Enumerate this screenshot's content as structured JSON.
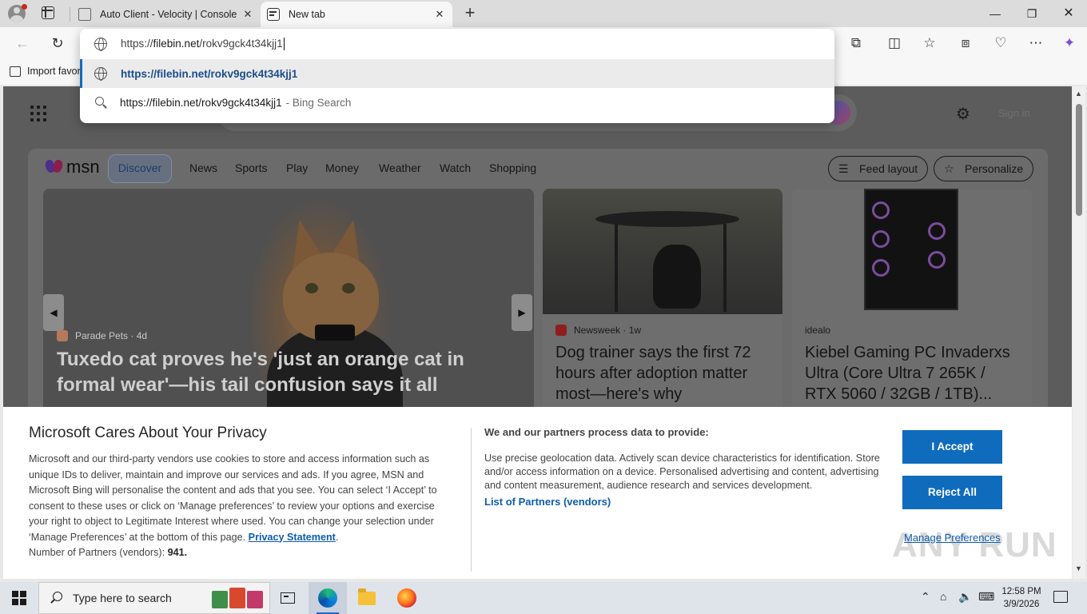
{
  "browser": {
    "tabs": [
      {
        "title": "Auto Client - Velocity | Console",
        "close": "✕"
      },
      {
        "title": "New tab",
        "close": "✕"
      }
    ],
    "new_tab_symbol": "+",
    "window_controls": {
      "minimize": "—",
      "maximize": "❐",
      "close": "✕"
    },
    "toolbar": {
      "back": "←",
      "reload": "↻",
      "icons": [
        "extensions-icon",
        "split-screen-icon",
        "favorites-icon",
        "collections-icon",
        "browser-essentials-icon",
        "more-icon",
        "copilot-icon"
      ]
    },
    "favorites_bar": {
      "import": "Import favor"
    }
  },
  "omnibox": {
    "input_prefix": "https://",
    "input_host": "filebin.net",
    "input_path": "/rokv9gck4t34kjj1",
    "suggestions": [
      {
        "text": "https://filebin.net/rokv9gck4t34kjj1",
        "kind": "url"
      },
      {
        "text": "https://filebin.net/rokv9gck4t34kjj1",
        "suffix": "- Bing Search",
        "kind": "search"
      }
    ]
  },
  "msn": {
    "logo_text": "msn",
    "nav": [
      "Discover",
      "News",
      "Sports",
      "Play",
      "Money",
      "Weather",
      "Watch",
      "Shopping"
    ],
    "feed_layout": "Feed layout",
    "personalize": "Personalize",
    "signin": "Sign in",
    "cards": [
      {
        "source": "Parade Pets",
        "age": "4d",
        "title": "Tuxedo cat proves he's 'just an orange cat in formal wear'—his tail confusion says it all"
      },
      {
        "source": "Newsweek",
        "age": "1w",
        "title": "Dog trainer says the first 72 hours after adoption matter most—here's why"
      },
      {
        "source": "idealo",
        "title": "Kiebel Gaming PC Invaderxs Ultra (Core Ultra 7 265K / RTX 5060 / 32GB / 1TB)..."
      }
    ]
  },
  "privacy": {
    "heading": "Microsoft Cares About Your Privacy",
    "body": "Microsoft and our third-party vendors use cookies to store and access information such as unique IDs to deliver, maintain and improve our services and ads. If you agree, MSN and Microsoft Bing will personalise the content and ads that you see. You can select ‘I Accept’ to consent to these uses or click on ‘Manage preferences’ to review your options and exercise your right to object to Legitimate Interest where used.  You can change your selection under ‘Manage Preferences’ at the bottom of this page.",
    "privacy_link": "Privacy Statement",
    "partners_label": "Number of Partners (vendors):",
    "partners_count": "941",
    "subheading": "We and our partners process data to provide:",
    "purposes": "Use precise geolocation data. Actively scan device characteristics for identification. Store and/or access information on a device. Personalised advertising and content, advertising and content measurement, audience research and services development.",
    "partners_link": "List of Partners (vendors)",
    "accept": "I Accept",
    "reject": "Reject All",
    "manage": "Manage Preferences"
  },
  "watermark": "ANY RUN",
  "taskbar": {
    "search_placeholder": "Type here to search",
    "time": "12:58 PM",
    "date": "3/9/2026"
  },
  "colors": {
    "accent": "#0f6cbd",
    "link": "#0f5cb0"
  }
}
